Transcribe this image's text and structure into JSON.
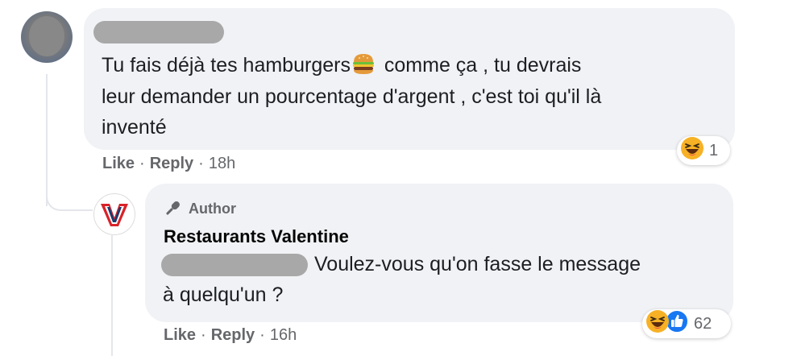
{
  "comment": {
    "text_line1_before": "Tu fais déjà tes hamburgers",
    "text_line1_after": " comme ça , tu devrais",
    "text_line2": "leur demander un pourcentage d'argent , c'est toi qu'il là",
    "text_line3": "inventé",
    "inline_emoji": "hamburger-icon",
    "actions": {
      "like": "Like",
      "reply": "Reply",
      "separator": "·",
      "time": "18h"
    },
    "reactions": {
      "icons": [
        "laughing-icon"
      ],
      "count": "1"
    }
  },
  "reply": {
    "badge": "Author",
    "author_name": "Restaurants Valentine",
    "text_line1": "Voulez-vous qu'on fasse le message",
    "text_line2": "à quelqu'un ?",
    "actions": {
      "like": "Like",
      "reply": "Reply",
      "separator": "·",
      "time": "16h"
    },
    "reactions": {
      "icons": [
        "laughing-icon",
        "thumbs-up-icon"
      ],
      "count": "62"
    }
  },
  "colors": {
    "bubble": "#f0f2f5",
    "meta_text": "#65676b",
    "like_blue": "#1877f2",
    "haha_yellow": "#f7b125",
    "brand_red": "#d8232a",
    "brand_navy": "#1c3a6e"
  }
}
